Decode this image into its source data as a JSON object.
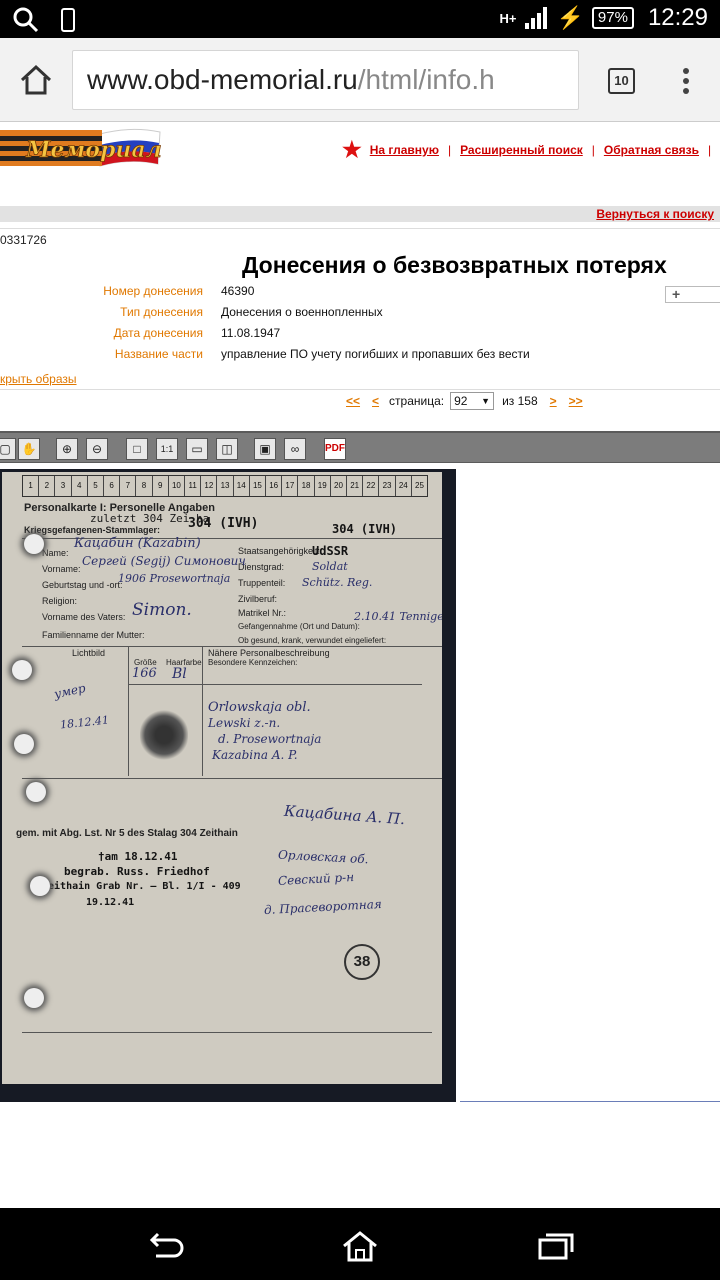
{
  "status": {
    "signal": "H+",
    "battery": "97%",
    "time": "12:29"
  },
  "browser": {
    "url_host": "www.obd-memorial.ru",
    "url_path": "/html/info.h",
    "tab_count": "10"
  },
  "site": {
    "nav": [
      "На главную",
      "Расширенный поиск",
      "Обратная связь"
    ],
    "back_link": "Вернуться к поиску",
    "doc_id": "0331726",
    "title": "Донесения о безвозвратных потерях",
    "expand": "+",
    "fields": [
      {
        "label": "Номер донесения",
        "value": "46390"
      },
      {
        "label": "Тип донесения",
        "value": "Донесения о военнопленных"
      },
      {
        "label": "Дата донесения",
        "value": "11.08.1947"
      },
      {
        "label": "Название части",
        "value": "управление ПО учету погибших и пропавших без вести"
      }
    ],
    "hide_images": "крыть образы",
    "pager": {
      "first": "<<",
      "prev": "<",
      "label": "страница:",
      "current": "92",
      "of": "из 158",
      "next": ">",
      "last": ">>"
    }
  },
  "toolbar": [
    "hand-tool",
    "zoom-in",
    "zoom-out",
    "fit-page",
    "actual-size",
    "fit-width",
    "two-page",
    "save",
    "link",
    "pdf"
  ],
  "document": {
    "strip_numbers": [
      "1",
      "2",
      "3",
      "4",
      "5",
      "6",
      "7",
      "8",
      "9",
      "10",
      "11",
      "12",
      "13",
      "14",
      "15",
      "16",
      "17",
      "18",
      "19",
      "20",
      "21",
      "22",
      "23",
      "24",
      "25"
    ],
    "header_printed": "Personalkarte I: Personelle Angaben",
    "header_sub": "Kriegsgefangenen-Stammlager:",
    "header_handwritten": "zuletzt 304 Zei ha",
    "stalag_stamp": "304 (IVH)",
    "lager_stamp": "304 (IVH)",
    "nationality": "UdSSR",
    "surname": "Кацабин (Kazabin)",
    "first_name": "Сергей (Segij)  Симонович",
    "birth": "1906  Prosewortnaja",
    "father": "Simon.",
    "rank": "Soldat",
    "unit": "Schütz. Reg.",
    "captured": "2.10.41  Tennige",
    "height": "166",
    "hair": "Bl",
    "note_died": "умер",
    "note_date": "18.12.41",
    "relative_addr": [
      "Orlowskaja obl.",
      "Lewski z.-n.",
      "d. Prosewortnaja",
      "Kazabina A. P."
    ],
    "abg_line": "gem. mit Abg. Lst. Nr  5  des Stalag  304 Zeithain",
    "relative_ru": "Кацабина А. П.",
    "addr_ru": [
      "Орловская об.",
      "Севский р-н",
      "д. Прасеворотная"
    ],
    "death_stamp": [
      "†am 18.12.41",
      "begrab. Russ. Friedhof",
      "Zeithain Grab Nr. —  Bl. 1/I - 409",
      "19.12.41"
    ],
    "circle_number": "38",
    "row_labels": [
      "Name:",
      "Vorname:",
      "Geburtstag und -ort:",
      "Religion:",
      "Vorname des Vaters:",
      "Familienname der Mutter:",
      "Staatsangehörigkeit:",
      "Dienstgrad:",
      "Truppenteil:",
      "Zivilberuf:",
      "Matrikel Nr.:",
      "Gefangennahme (Ort und Datum):",
      "Ob gesund, krank, verwundet eingeliefert:",
      "Lichtbild",
      "Größe",
      "Haarfarbe",
      "Nähere Personalbeschreibung",
      "Besondere Kennzeichen:"
    ]
  }
}
